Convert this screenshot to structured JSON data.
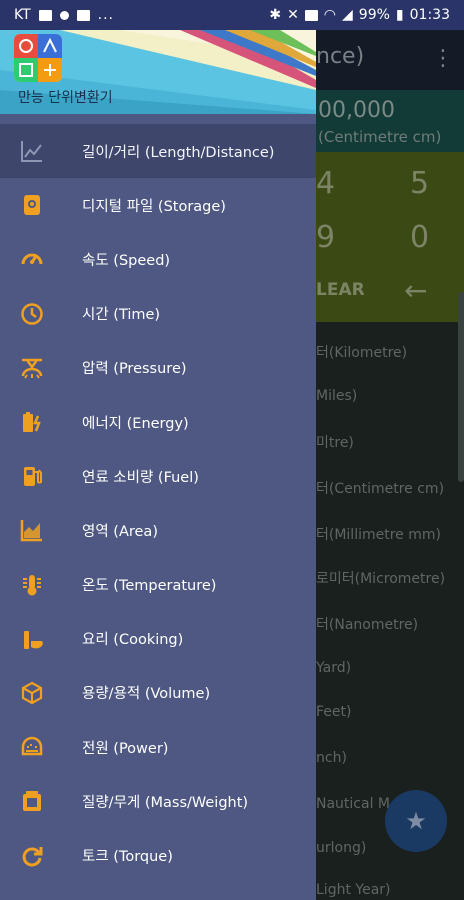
{
  "status_bar": {
    "carrier": "KT",
    "dots": "...",
    "battery": "99%",
    "time": "01:33"
  },
  "background": {
    "title_partial": "nce)",
    "menu_icon": "more-vert-icon",
    "display_value": "00,000",
    "display_unit": "(Centimetre cm)",
    "keys": [
      "4",
      "5",
      "9",
      "0"
    ],
    "clear_label": "LEAR",
    "back_icon": "←",
    "list_items": [
      "터(Kilometre)",
      "Miles)",
      "미tre)",
      "터(Centimetre cm)",
      "터(Millimetre mm)",
      "로미터(Micrometre)",
      "터(Nanometre)",
      "Yard)",
      "Feet)",
      "nch)",
      "Nautical M",
      "urlong)",
      "Light Year)"
    ],
    "fab_icon": "★"
  },
  "drawer": {
    "app_name": "만능 단위변환기",
    "accent_color": "#f0a020",
    "items": [
      {
        "label": "길이/거리 (Length/Distance)",
        "icon": "line-chart-icon",
        "active": true
      },
      {
        "label": "디지털 파일 (Storage)",
        "icon": "storage-icon",
        "active": false
      },
      {
        "label": "속도 (Speed)",
        "icon": "speedometer-icon",
        "active": false
      },
      {
        "label": "시간 (Time)",
        "icon": "clock-icon",
        "active": false
      },
      {
        "label": "압력 (Pressure)",
        "icon": "pressure-icon",
        "active": false
      },
      {
        "label": "에너지 (Energy)",
        "icon": "battery-charging-icon",
        "active": false
      },
      {
        "label": "연료 소비량 (Fuel)",
        "icon": "fuel-pump-icon",
        "active": false
      },
      {
        "label": "영역 (Area)",
        "icon": "area-chart-icon",
        "active": false
      },
      {
        "label": "온도 (Temperature)",
        "icon": "thermometer-icon",
        "active": false
      },
      {
        "label": "요리 (Cooking)",
        "icon": "cooking-icon",
        "active": false
      },
      {
        "label": "용량/용적 (Volume)",
        "icon": "cube-icon",
        "active": false
      },
      {
        "label": "전원 (Power)",
        "icon": "power-gauge-icon",
        "active": false
      },
      {
        "label": "질량/무게 (Mass/Weight)",
        "icon": "weight-icon",
        "active": false
      },
      {
        "label": "토크 (Torque)",
        "icon": "torque-icon",
        "active": false
      }
    ]
  }
}
